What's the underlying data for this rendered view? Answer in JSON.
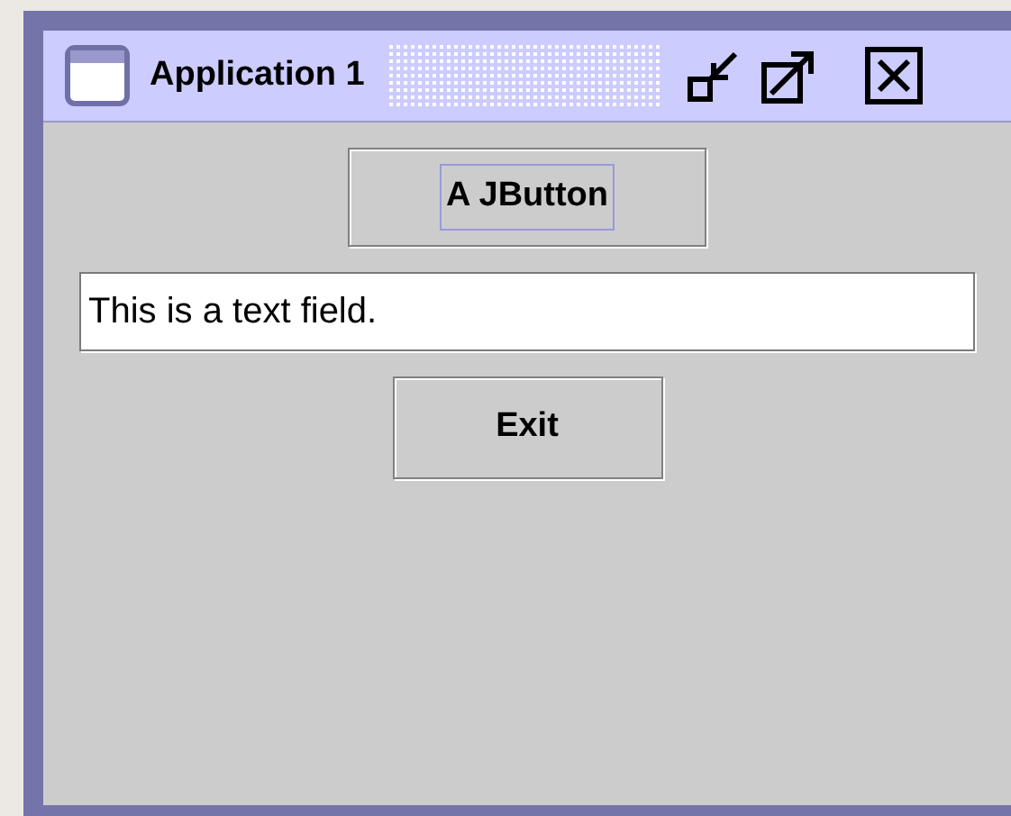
{
  "window": {
    "title": "Application 1"
  },
  "content": [
    {
      "kind": "button",
      "label": "A JButton",
      "focused": true
    },
    {
      "kind": "text_field",
      "value": "This is a text field."
    },
    {
      "kind": "button",
      "label": "Exit",
      "focused": false
    }
  ]
}
